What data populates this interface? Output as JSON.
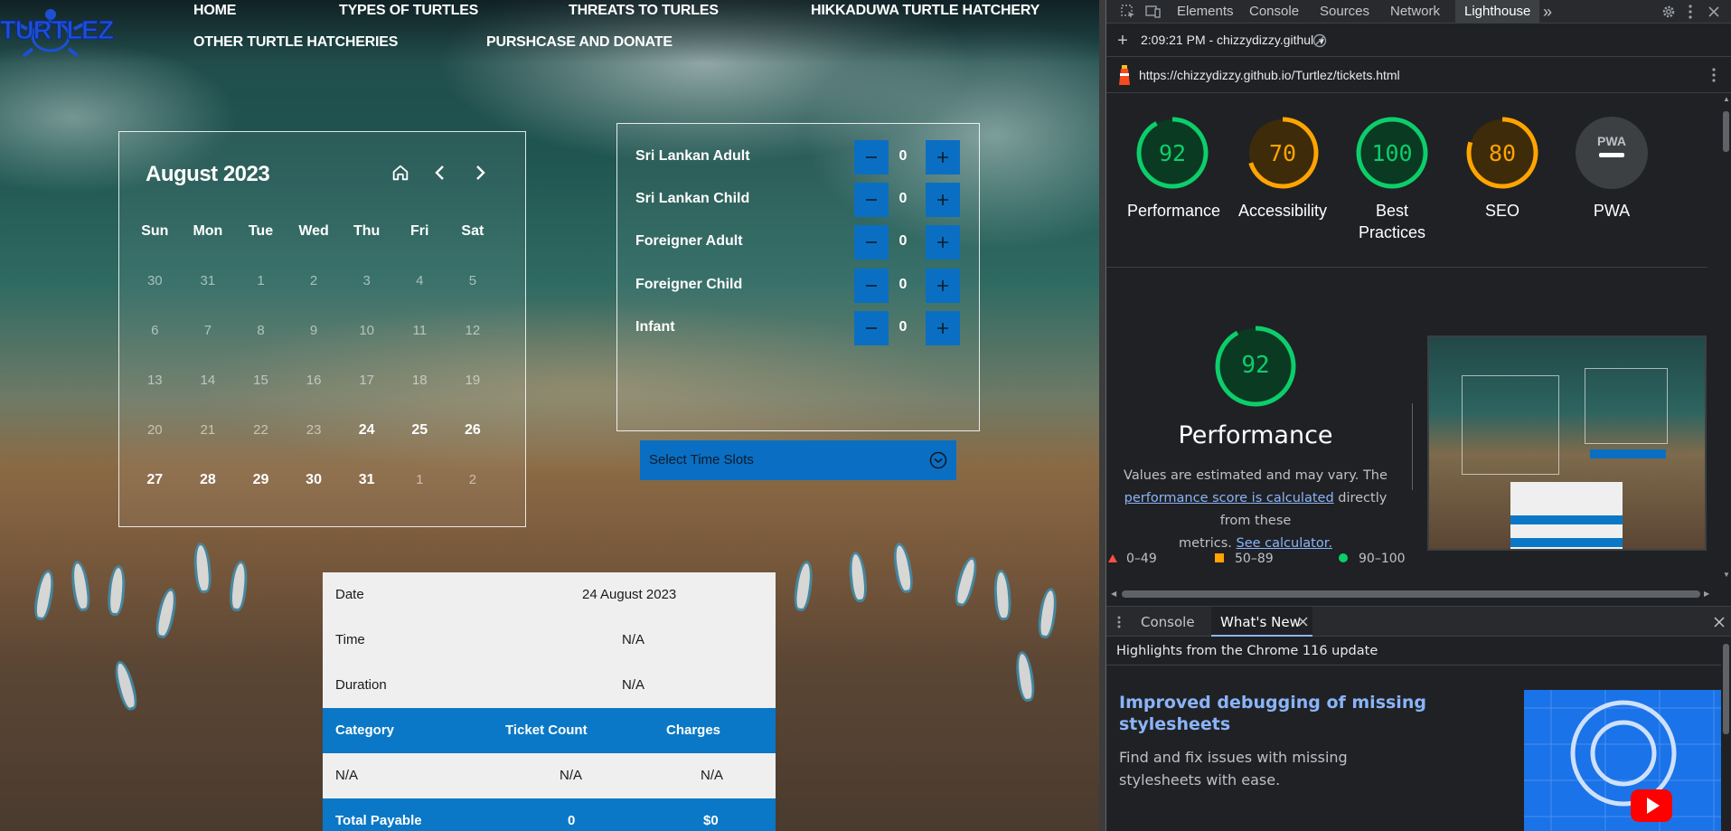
{
  "site": {
    "logo_text": "TURTLEZ",
    "nav": {
      "home": "HOME",
      "types": "TYPES OF TURTLES",
      "threats": "THREATS TO TURLES",
      "hikkaduwa": "HIKKADUWA TURTLE HATCHERY",
      "other": "OTHER TURTLE HATCHERIES",
      "purchase": "PURSHCASE AND DONATE"
    },
    "calendar": {
      "title": "August 2023",
      "weekdays": [
        "Sun",
        "Mon",
        "Tue",
        "Wed",
        "Thu",
        "Fri",
        "Sat"
      ],
      "weeks": [
        [
          {
            "d": "30",
            "on": false
          },
          {
            "d": "31",
            "on": false
          },
          {
            "d": "1",
            "on": false
          },
          {
            "d": "2",
            "on": false
          },
          {
            "d": "3",
            "on": false
          },
          {
            "d": "4",
            "on": false
          },
          {
            "d": "5",
            "on": false
          }
        ],
        [
          {
            "d": "6",
            "on": false
          },
          {
            "d": "7",
            "on": false
          },
          {
            "d": "8",
            "on": false
          },
          {
            "d": "9",
            "on": false
          },
          {
            "d": "10",
            "on": false
          },
          {
            "d": "11",
            "on": false
          },
          {
            "d": "12",
            "on": false
          }
        ],
        [
          {
            "d": "13",
            "on": false
          },
          {
            "d": "14",
            "on": false
          },
          {
            "d": "15",
            "on": false
          },
          {
            "d": "16",
            "on": false
          },
          {
            "d": "17",
            "on": false
          },
          {
            "d": "18",
            "on": false
          },
          {
            "d": "19",
            "on": false
          }
        ],
        [
          {
            "d": "20",
            "on": false
          },
          {
            "d": "21",
            "on": false
          },
          {
            "d": "22",
            "on": false
          },
          {
            "d": "23",
            "on": false
          },
          {
            "d": "24",
            "on": true
          },
          {
            "d": "25",
            "on": true
          },
          {
            "d": "26",
            "on": true
          }
        ],
        [
          {
            "d": "27",
            "on": true
          },
          {
            "d": "28",
            "on": true
          },
          {
            "d": "29",
            "on": true
          },
          {
            "d": "30",
            "on": true
          },
          {
            "d": "31",
            "on": true
          },
          {
            "d": "1",
            "on": false
          },
          {
            "d": "2",
            "on": false
          }
        ]
      ]
    },
    "tickets": [
      {
        "label": "Sri Lankan Adult",
        "count": "0"
      },
      {
        "label": "Sri Lankan Child",
        "count": "0"
      },
      {
        "label": "Foreigner Adult",
        "count": "0"
      },
      {
        "label": "Foreigner Child",
        "count": "0"
      },
      {
        "label": "Infant",
        "count": "0"
      }
    ],
    "time_slot_label": "Select Time Slots",
    "summary": {
      "date_label": "Date",
      "date_value": "24 August 2023",
      "time_label": "Time",
      "time_value": "N/A",
      "duration_label": "Duration",
      "duration_value": "N/A",
      "col_category": "Category",
      "col_count": "Ticket Count",
      "col_charges": "Charges",
      "row_category": "N/A",
      "row_count": "N/A",
      "row_charges": "N/A",
      "total_label": "Total Payable",
      "total_count": "0",
      "total_charges": "$0"
    }
  },
  "devtools": {
    "tabs": [
      "Elements",
      "Console",
      "Sources",
      "Network",
      "Lighthouse"
    ],
    "active_tab": "Lighthouse",
    "report_selector": "2:09:21 PM - chizzydizzy.githul",
    "url": "https://chizzydizzy.github.io/Turtlez/tickets.html",
    "scores": [
      {
        "label": "Performance",
        "value": "92",
        "color": "#0cce6b"
      },
      {
        "label": "Accessibility",
        "value": "70",
        "color": "#ffa400"
      },
      {
        "label": "Best Practices",
        "value": "100",
        "color": "#0cce6b"
      },
      {
        "label": "SEO",
        "value": "80",
        "color": "#ffa400"
      },
      {
        "label": "PWA",
        "value": "PWA",
        "color": "#9aa0a6"
      }
    ],
    "perf_detail": {
      "score": "92",
      "title": "Performance",
      "desc_1": "Values are estimated and may vary. The",
      "desc_link": "performance score is calculated",
      "desc_2": "directly from these",
      "desc_3": "metrics.",
      "calc_link": "See calculator."
    },
    "legend": {
      "low": "0–49",
      "mid": "50–89",
      "high": "90–100"
    },
    "drawer_tabs": {
      "console": "Console",
      "whats_new": "What's New"
    },
    "whats_new": {
      "header": "Highlights from the Chrome 116 update",
      "card_title": "Improved debugging of missing stylesheets",
      "card_body": "Find and fix issues with missing stylesheets with ease."
    }
  }
}
